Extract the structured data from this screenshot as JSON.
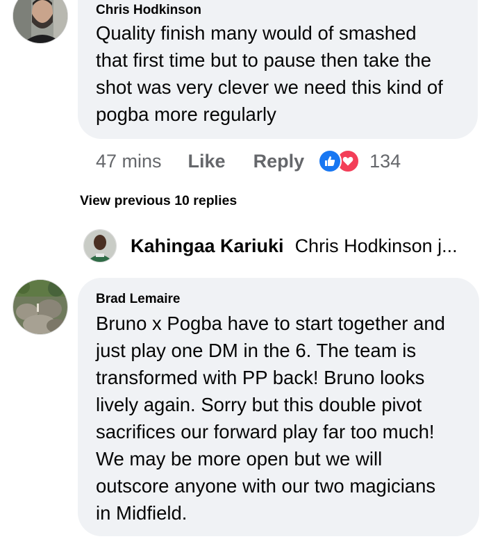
{
  "comments": [
    {
      "author": "Chris Hodkinson",
      "text_lines": [
        "Quality finish many would of smashed",
        "that first time but to pause then take the",
        "shot was very clever we need this kind of",
        "pogba more regularly"
      ],
      "time": "47 mins",
      "like_label": "Like",
      "reply_label": "Reply",
      "reaction_count": "134",
      "reactions": [
        "like-icon",
        "love-icon"
      ],
      "avatar": "man-with-beard-avatar"
    },
    {
      "author": "Brad Lemaire",
      "text_lines": [
        "Bruno x Pogba have to start together and",
        "just play one DM in the 6. The team is",
        "transformed with PP back! Bruno looks",
        "lively again. Sorry but this double pivot",
        "sacrifices our forward play far too much!",
        "We may be more open but we will",
        "outscore anyone with our two magicians",
        "in Midfield."
      ],
      "avatar": "outdoor-rocks-avatar"
    }
  ],
  "view_previous_label": "View previous 10 replies",
  "reply_preview": {
    "author": "Kahingaa Kariuki",
    "text": "Chris Hodkinson j...",
    "avatar": "man-green-shirt-avatar"
  },
  "colors": {
    "bubble": "#f0f2f5",
    "secondary_text": "#65676b",
    "like_blue": "#1877f2",
    "love_red": "#f33e58"
  }
}
